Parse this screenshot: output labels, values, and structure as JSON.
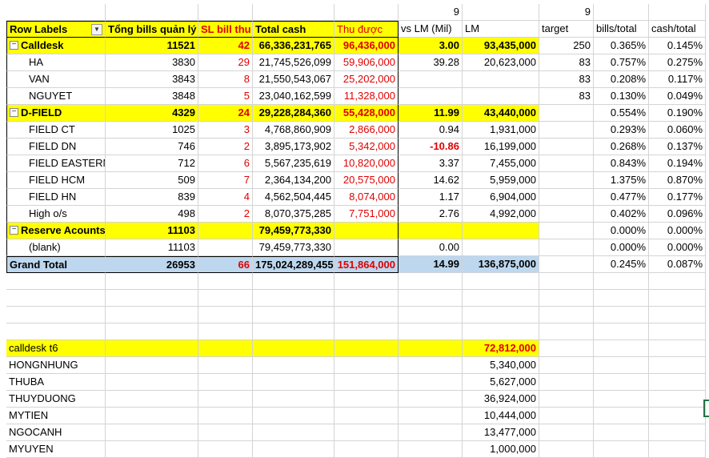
{
  "top_numbers": {
    "lm_month": "9",
    "target_month": "9"
  },
  "headers": {
    "row_labels": "Row Labels",
    "tong_bills": "Tổng bills quản lý",
    "sl_bill_thu": "SL bill thu",
    "total_cash": "Total cash",
    "thu_duoc": "Thu được",
    "vs_lm": "vs LM (Mil)",
    "lm": "LM",
    "target": "target",
    "bills_total": "bills/total",
    "cash_total": "cash/total"
  },
  "rows": [
    {
      "label": "Calldesk",
      "group": true,
      "bills": "11521",
      "sl": "42",
      "cash": "66,336,231,765",
      "thu": "96,436,000",
      "vs": "3.00",
      "lm": "93,435,000",
      "target": "250",
      "bt": "0.365%",
      "ct": "0.145%"
    },
    {
      "label": "HA",
      "group": false,
      "bills": "3830",
      "sl": "29",
      "cash": "21,745,526,099",
      "thu": "59,906,000",
      "vs": "39.28",
      "lm": "20,623,000",
      "target": "83",
      "bt": "0.757%",
      "ct": "0.275%"
    },
    {
      "label": "VAN",
      "group": false,
      "bills": "3843",
      "sl": "8",
      "cash": "21,550,543,067",
      "thu": "25,202,000",
      "vs": "",
      "lm": "",
      "target": "83",
      "bt": "0.208%",
      "ct": "0.117%"
    },
    {
      "label": "NGUYET",
      "group": false,
      "bills": "3848",
      "sl": "5",
      "cash": "23,040,162,599",
      "thu": "11,328,000",
      "vs": "",
      "lm": "",
      "target": "83",
      "bt": "0.130%",
      "ct": "0.049%"
    },
    {
      "label": "D-FIELD",
      "group": true,
      "bills": "4329",
      "sl": "24",
      "cash": "29,228,284,360",
      "thu": "55,428,000",
      "vs": "11.99",
      "lm": "43,440,000",
      "target": "",
      "bt": "0.554%",
      "ct": "0.190%"
    },
    {
      "label": "FIELD CT",
      "group": false,
      "bills": "1025",
      "sl": "3",
      "cash": "4,768,860,909",
      "thu": "2,866,000",
      "vs": "0.94",
      "lm": "1,931,000",
      "target": "",
      "bt": "0.293%",
      "ct": "0.060%"
    },
    {
      "label": "FIELD DN",
      "group": false,
      "bills": "746",
      "sl": "2",
      "cash": "3,895,173,902",
      "thu": "5,342,000",
      "vs": "-10.86",
      "lm": "16,199,000",
      "target": "",
      "bt": "0.268%",
      "ct": "0.137%",
      "vs_neg": true
    },
    {
      "label": "FIELD EASTERN",
      "group": false,
      "bills": "712",
      "sl": "6",
      "cash": "5,567,235,619",
      "thu": "10,820,000",
      "vs": "3.37",
      "lm": "7,455,000",
      "target": "",
      "bt": "0.843%",
      "ct": "0.194%"
    },
    {
      "label": "FIELD HCM",
      "group": false,
      "bills": "509",
      "sl": "7",
      "cash": "2,364,134,200",
      "thu": "20,575,000",
      "vs": "14.62",
      "lm": "5,959,000",
      "target": "",
      "bt": "1.375%",
      "ct": "0.870%"
    },
    {
      "label": "FIELD HN",
      "group": false,
      "bills": "839",
      "sl": "4",
      "cash": "4,562,504,445",
      "thu": "8,074,000",
      "vs": "1.17",
      "lm": "6,904,000",
      "target": "",
      "bt": "0.477%",
      "ct": "0.177%"
    },
    {
      "label": "High o/s",
      "group": false,
      "bills": "498",
      "sl": "2",
      "cash": "8,070,375,285",
      "thu": "7,751,000",
      "vs": "2.76",
      "lm": "4,992,000",
      "target": "",
      "bt": "0.402%",
      "ct": "0.096%"
    },
    {
      "label": "Reserve Acounts",
      "group": true,
      "bills": "11103",
      "sl": "",
      "cash": "79,459,773,330",
      "thu": "",
      "vs": "",
      "lm": "",
      "target": "",
      "bt": "0.000%",
      "ct": "0.000%"
    },
    {
      "label": "(blank)",
      "group": false,
      "bills": "11103",
      "sl": "",
      "cash": "79,459,773,330",
      "thu": "",
      "vs": "0.00",
      "lm": "",
      "target": "",
      "bt": "0.000%",
      "ct": "0.000%"
    }
  ],
  "grand_total": {
    "label": "Grand Total",
    "bills": "26953",
    "sl": "66",
    "cash": "175,024,289,455",
    "thu": "151,864,000",
    "vs": "14.99",
    "lm": "136,875,000",
    "bt": "0.245%",
    "ct": "0.087%"
  },
  "calldesk_t6": {
    "title": "calldesk t6",
    "total": "72,812,000",
    "items": [
      {
        "name": "HONGNHUNG",
        "value": "5,340,000"
      },
      {
        "name": "THUBA",
        "value": "5,627,000"
      },
      {
        "name": "THUYDUONG",
        "value": "36,924,000"
      },
      {
        "name": "MYTIEN",
        "value": "10,444,000"
      },
      {
        "name": "NGOCANH",
        "value": "13,477,000"
      },
      {
        "name": "MYUYEN",
        "value": "1,000,000"
      }
    ]
  }
}
